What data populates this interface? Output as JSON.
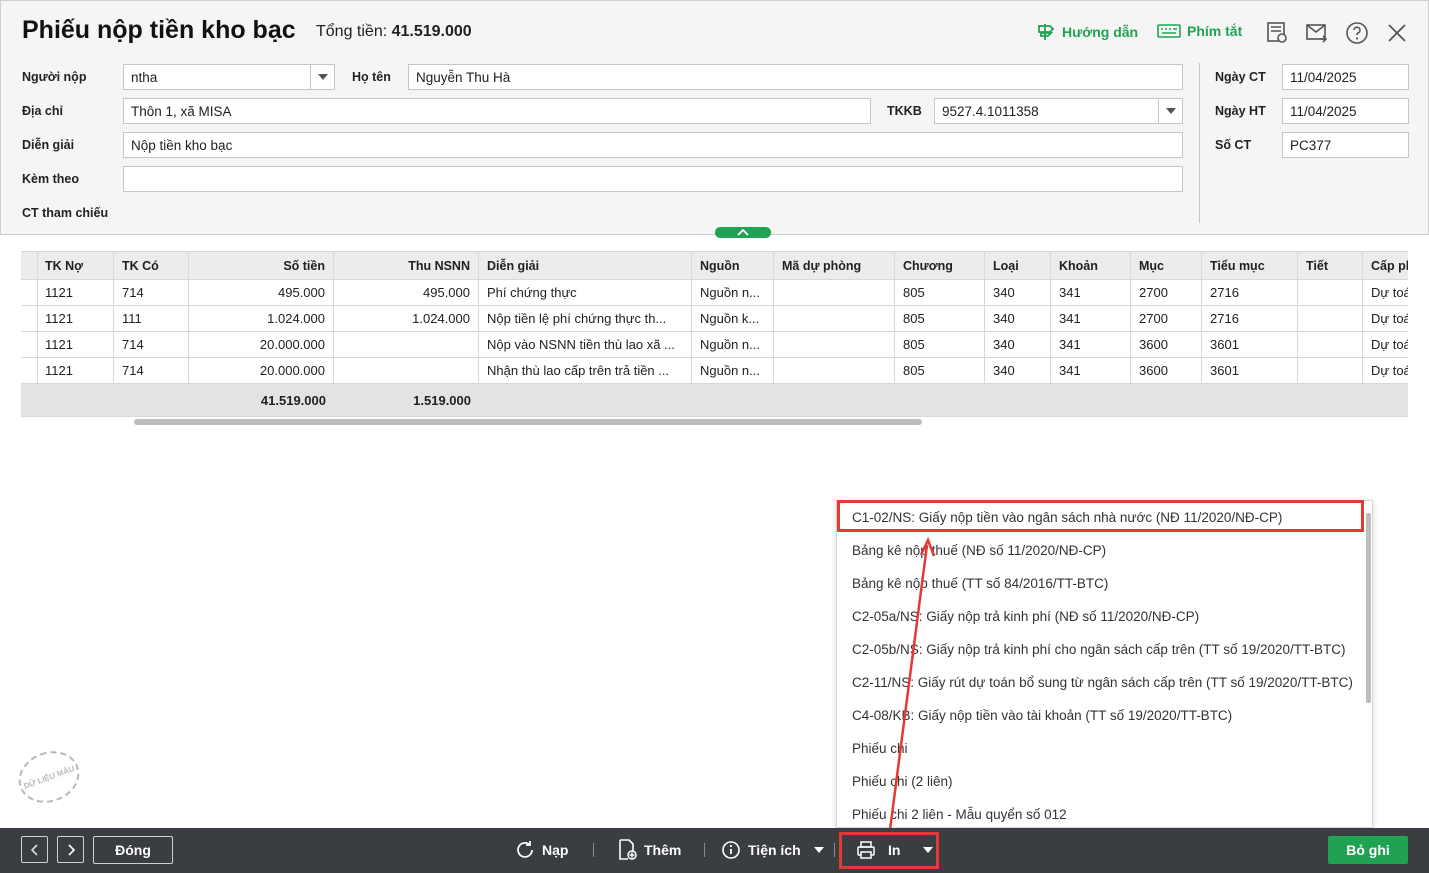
{
  "title": "Phiếu nộp tiền kho bạc",
  "total_label": "Tổng tiền:",
  "total_value": "41.519.000",
  "toolbar": {
    "guide": "Hướng dẫn",
    "shortcuts": "Phím tắt"
  },
  "form": {
    "payer_label": "Người nộp",
    "payer_value": "ntha",
    "name_label": "Họ tên",
    "name_value": "Nguyễn Thu Hà",
    "address_label": "Địa chỉ",
    "address_value": "Thôn 1, xã MISA",
    "tkkb_label": "TKKB",
    "tkkb_value": "9527.4.1011358",
    "desc_label": "Diễn giải",
    "desc_value": "Nộp tiền kho bạc",
    "attach_label": "Kèm theo",
    "attach_value": "",
    "ref_label": "CT tham chiếu",
    "date_ct_label": "Ngày CT",
    "date_ct_value": "11/04/2025",
    "date_ht_label": "Ngày HT",
    "date_ht_value": "11/04/2025",
    "so_ct_label": "Số CT",
    "so_ct_value": "PC377"
  },
  "table": {
    "columns": [
      "TK Nợ",
      "TK Có",
      "Số tiền",
      "Thu NSNN",
      "Diễn giải",
      "Nguồn",
      "Mã dự phòng",
      "Chương",
      "Loại",
      "Khoản",
      "Mục",
      "Tiểu mục",
      "Tiết",
      "Cấp phát"
    ],
    "rows": [
      [
        "1121",
        "714",
        "495.000",
        "495.000",
        "Phí chứng thực",
        "Nguồn n...",
        "",
        "805",
        "340",
        "341",
        "2700",
        "2716",
        "",
        "Dự toán"
      ],
      [
        "1121",
        "111",
        "1.024.000",
        "1.024.000",
        "Nộp tiền lệ phí chứng thực th...",
        "Nguồn k...",
        "",
        "805",
        "340",
        "341",
        "2700",
        "2716",
        "",
        "Dự toán"
      ],
      [
        "1121",
        "714",
        "20.000.000",
        "",
        "Nộp vào NSNN tiền thù lao xã ...",
        "Nguồn n...",
        "",
        "805",
        "340",
        "341",
        "3600",
        "3601",
        "",
        "Dự toán"
      ],
      [
        "1121",
        "714",
        "20.000.000",
        "",
        "Nhận thù lao cấp trên trả tiền ...",
        "Nguồn n...",
        "",
        "805",
        "340",
        "341",
        "3600",
        "3601",
        "",
        "Dự toán"
      ]
    ],
    "totals": {
      "amount": "41.519.000",
      "nsnn": "1.519.000"
    }
  },
  "print_menu": [
    "C1-02/NS: Giấy nộp tiền vào ngân sách nhà nước (NĐ 11/2020/NĐ-CP)",
    "Bảng kê nộp thuế (NĐ số 11/2020/NĐ-CP)",
    "Bảng kê nộp thuế (TT số 84/2016/TT-BTC)",
    "C2-05a/NS: Giấy nộp trả kinh phí (NĐ số 11/2020/NĐ-CP)",
    "C2-05b/NS: Giấy nộp trả kinh phí cho ngân sách cấp trên (TT số 19/2020/TT-BTC)",
    "C2-11/NS: Giấy rút dự toán bổ sung từ ngân sách cấp trên (TT số 19/2020/TT-BTC)",
    "C4-08/KB: Giấy nộp tiền vào tài khoản (TT số 19/2020/TT-BTC)",
    "Phiếu chi",
    "Phiếu chi (2 liên)",
    "Phiếu chi 2 liên - Mẫu quyển số 012"
  ],
  "footer": {
    "close": "Đóng",
    "reload": "Nạp",
    "add": "Thêm",
    "utilities": "Tiện ích",
    "print": "In",
    "save": "Bỏ ghi"
  },
  "watermark": "DỮ LIỆU MẪU",
  "colors": {
    "accent": "#1fa352",
    "highlight": "#e53935",
    "footer_bg": "#3a3d42"
  }
}
